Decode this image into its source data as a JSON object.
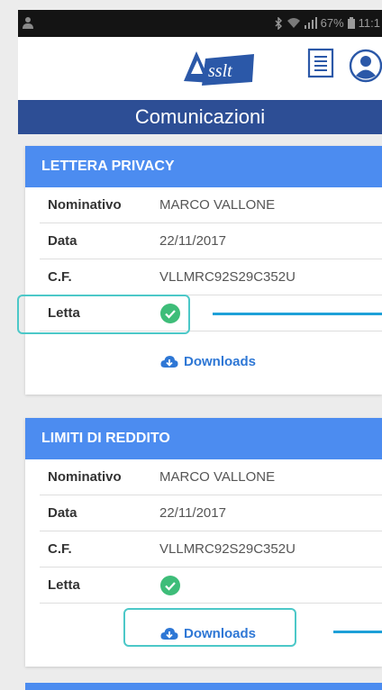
{
  "status_bar": {
    "battery": "67%",
    "time": "11:1"
  },
  "app_bar": {
    "logo_text": "Assilt"
  },
  "page_title": "Comunicazioni",
  "cards": [
    {
      "title": "LETTERA PRIVACY",
      "rows": [
        {
          "label": "Nominativo",
          "value": "MARCO VALLONE"
        },
        {
          "label": "Data",
          "value": "22/11/2017"
        },
        {
          "label": "C.F.",
          "value": "VLLMRC92S29C352U"
        },
        {
          "label": "Letta",
          "read": true
        }
      ],
      "download_label": "Downloads"
    },
    {
      "title": "LIMITI DI REDDITO",
      "rows": [
        {
          "label": "Nominativo",
          "value": "MARCO VALLONE"
        },
        {
          "label": "Data",
          "value": "22/11/2017"
        },
        {
          "label": "C.F.",
          "value": "VLLMRC92S29C352U"
        },
        {
          "label": "Letta",
          "read": true
        }
      ],
      "download_label": "Downloads"
    }
  ],
  "colors": {
    "title_bar": "#2d4e95",
    "card_header": "#4c8cf0",
    "link": "#2e77d5",
    "check": "#3ebd79",
    "highlight": "#4cc8c8",
    "pointer": "#1ea0d8"
  },
  "icons": {
    "document": "document-list-icon",
    "profile": "user-avatar-icon",
    "read": "check-circle-icon",
    "download": "cloud-download-icon"
  }
}
